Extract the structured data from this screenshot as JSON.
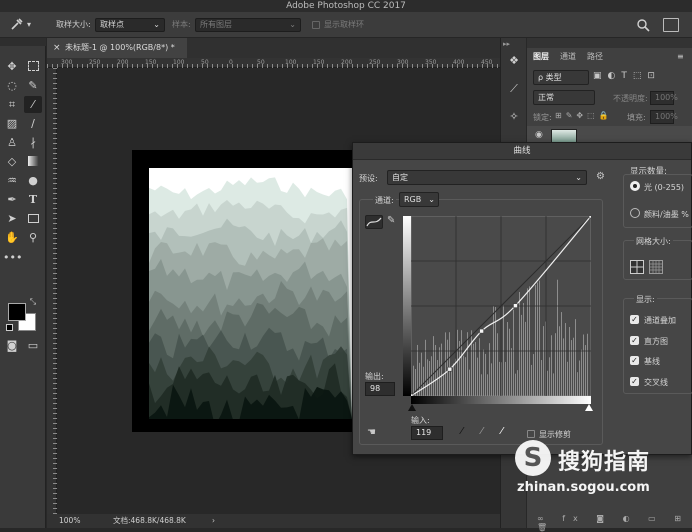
{
  "app": {
    "title": "Adobe Photoshop CC 2017"
  },
  "options_bar": {
    "sample_size_label": "取样大小:",
    "sample_size_value": "取样点",
    "sample_label": "样本:",
    "sample_value": "所有图层",
    "show_ring_label": "显示取样环"
  },
  "document": {
    "tab_title": "未标题-1 @ 100%(RGB/8*) *",
    "ruler_numbers": [
      "300",
      "250",
      "200",
      "150",
      "100",
      "50",
      "0",
      "50",
      "100",
      "150",
      "200",
      "250",
      "300",
      "350",
      "400",
      "450"
    ],
    "zoom": "100%",
    "doc_info": "文档:468.8K/468.8K"
  },
  "panels": {
    "tabs": [
      "图层",
      "通道",
      "路径"
    ],
    "kind_label": "ρ 类型",
    "blend_mode": "正常",
    "opacity_label": "不透明度:",
    "opacity_value": "100%",
    "lock_label": "锁定:",
    "fill_label": "填充:",
    "fill_value": "100%"
  },
  "curves": {
    "title": "曲线",
    "preset_label": "预设:",
    "preset_value": "自定",
    "channel_label": "通道:",
    "channel_value": "RGB",
    "display_amount_label": "显示数量:",
    "light_label": "光 (0-255)",
    "pigment_label": "颜料/油墨 %",
    "grid_size_label": "网格大小:",
    "show_label": "显示:",
    "show_options": [
      "通道叠加",
      "直方图",
      "基线",
      "交叉线"
    ],
    "output_label": "输出:",
    "output_value": "98",
    "input_label": "输入:",
    "input_value": "119",
    "show_clipping_label": "显示修剪",
    "curve_points": [
      [
        0,
        0
      ],
      [
        55,
        38
      ],
      [
        100,
        92
      ],
      [
        148,
        128
      ],
      [
        255,
        255
      ]
    ]
  },
  "watermark": {
    "logo_letter": "S",
    "brand": "搜狗指南",
    "url": "zhinan.sogou.com"
  },
  "colors": {
    "accent_teal": "#3f6f60",
    "deep_teal": "#1e3a31",
    "dialog_bg": "#464646"
  }
}
